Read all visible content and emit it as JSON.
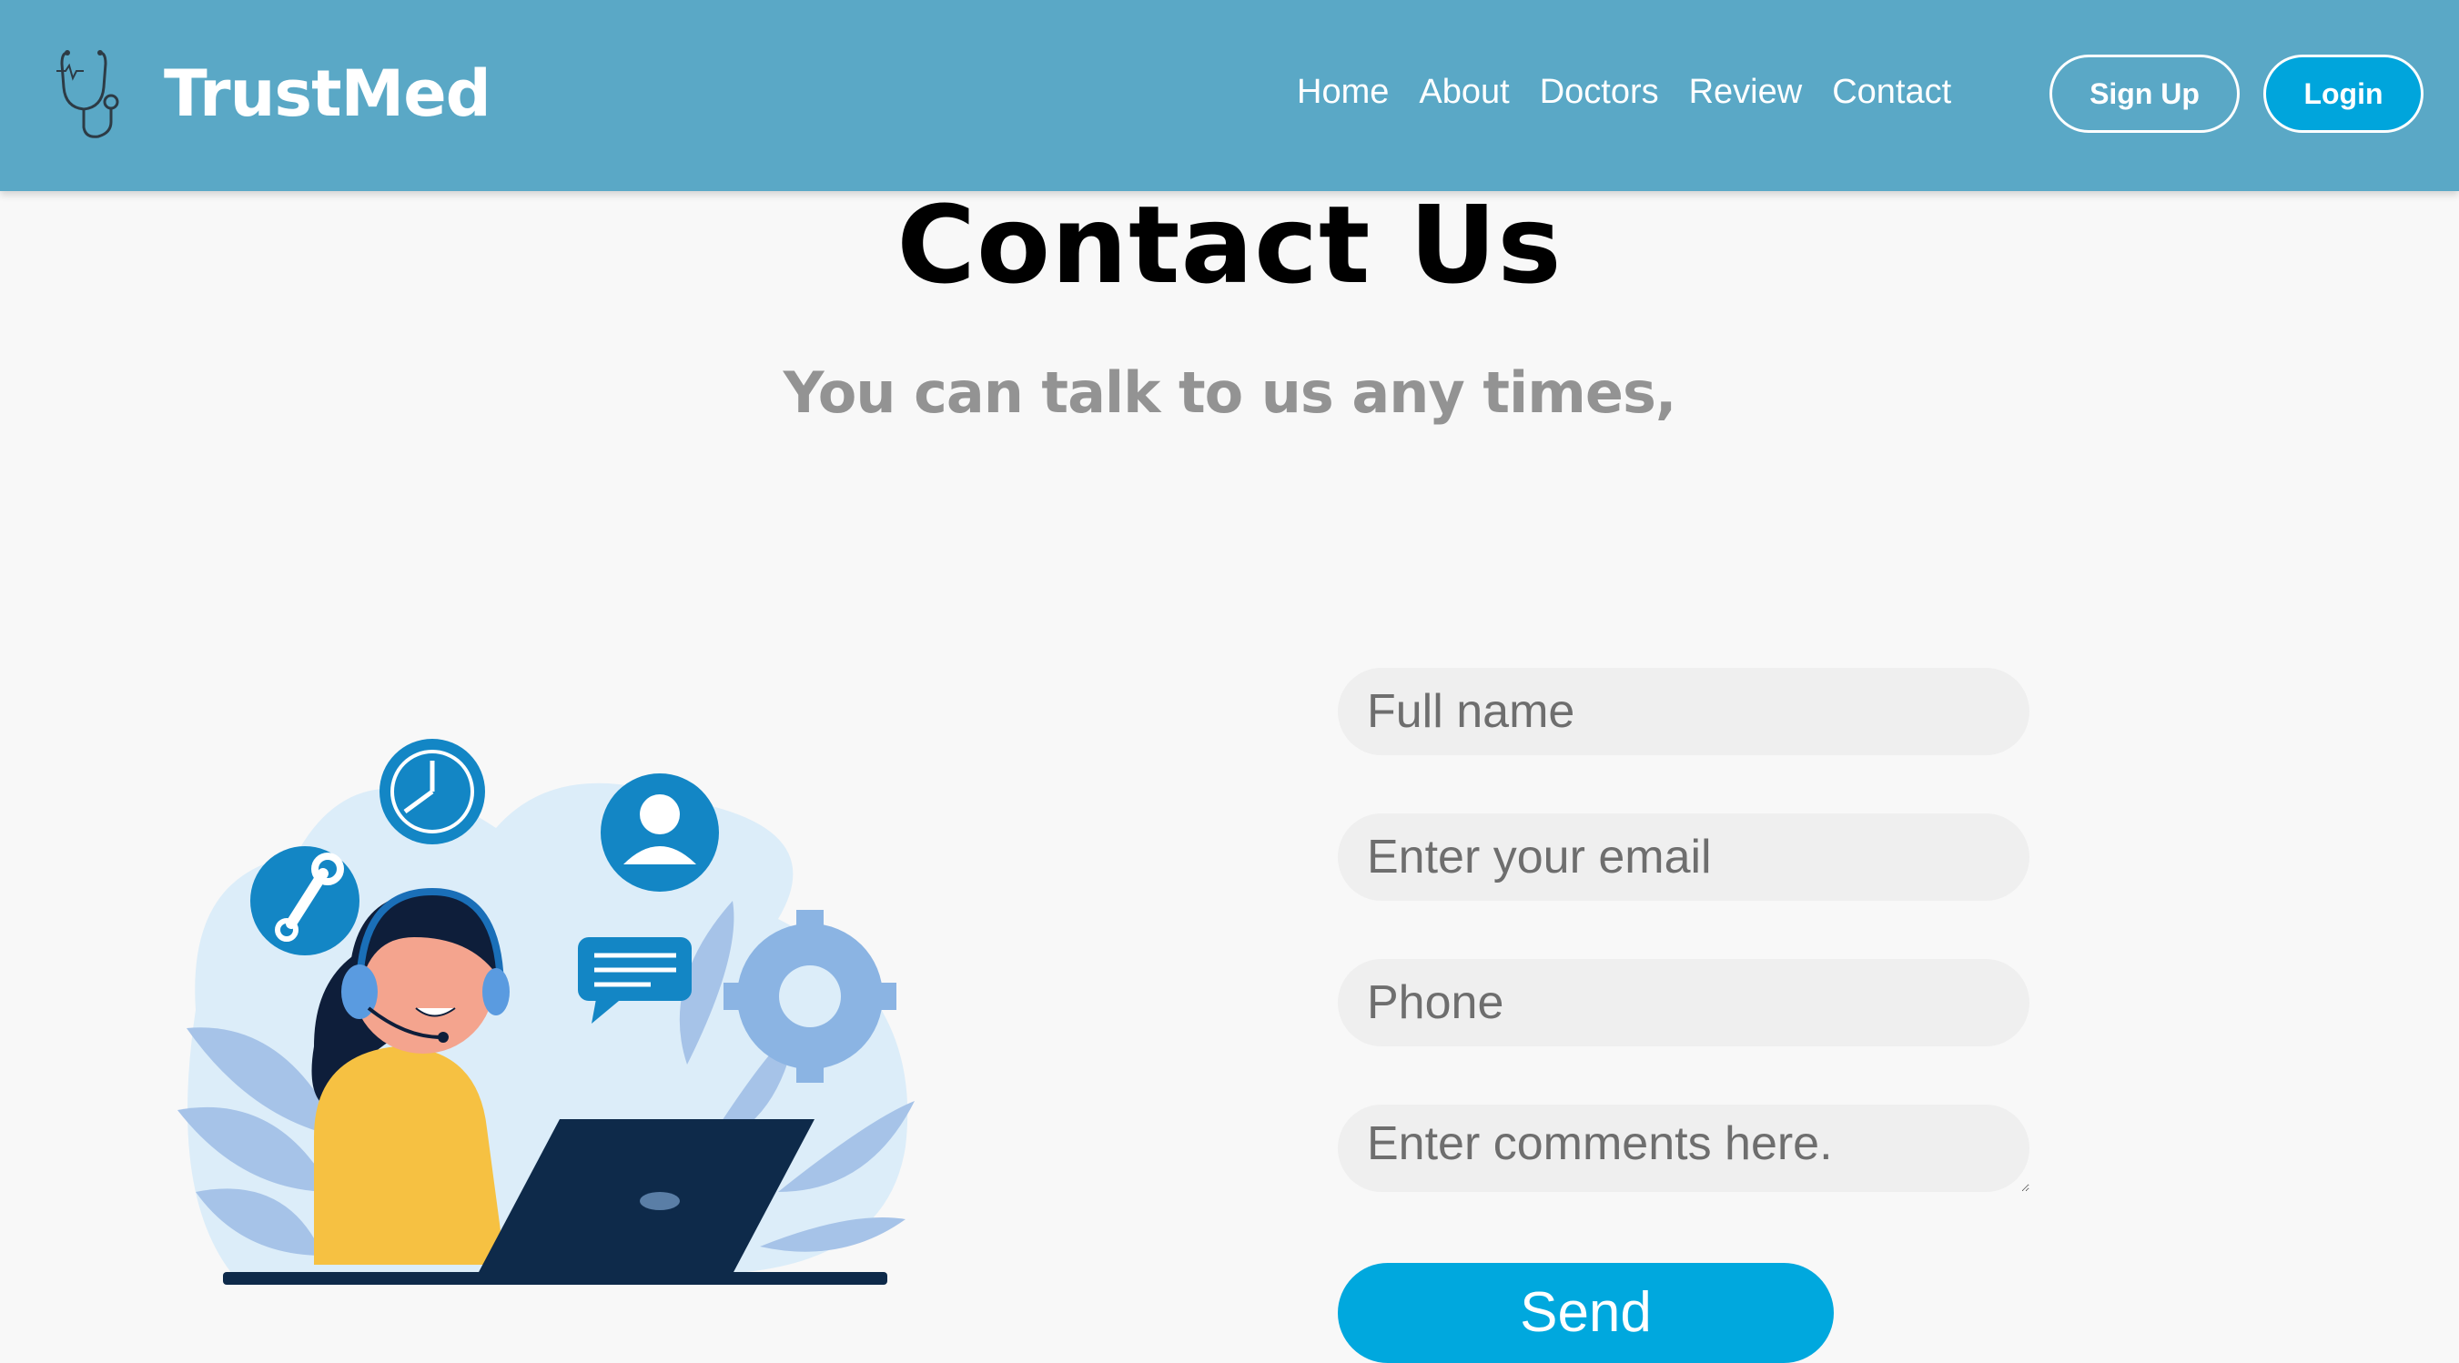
{
  "nav": {
    "brand": "TrustMed",
    "links": [
      "Home",
      "About",
      "Doctors",
      "Review",
      "Contact"
    ],
    "signup_label": "Sign Up",
    "login_label": "Login"
  },
  "main": {
    "title": "Contact Us",
    "subtitle": "You can talk to us any times,"
  },
  "form": {
    "name_placeholder": "Full name",
    "email_placeholder": "Enter your email",
    "phone_placeholder": "Phone",
    "comments_placeholder": "Enter comments here.",
    "send_label": "Send"
  },
  "icons": {
    "logo": "stethoscope-icon",
    "illustration": "customer-support-illustration"
  },
  "colors": {
    "header": "#5aa8c6",
    "accent": "#00a8de",
    "field_bg": "#efefef",
    "subtitle": "#939393"
  }
}
